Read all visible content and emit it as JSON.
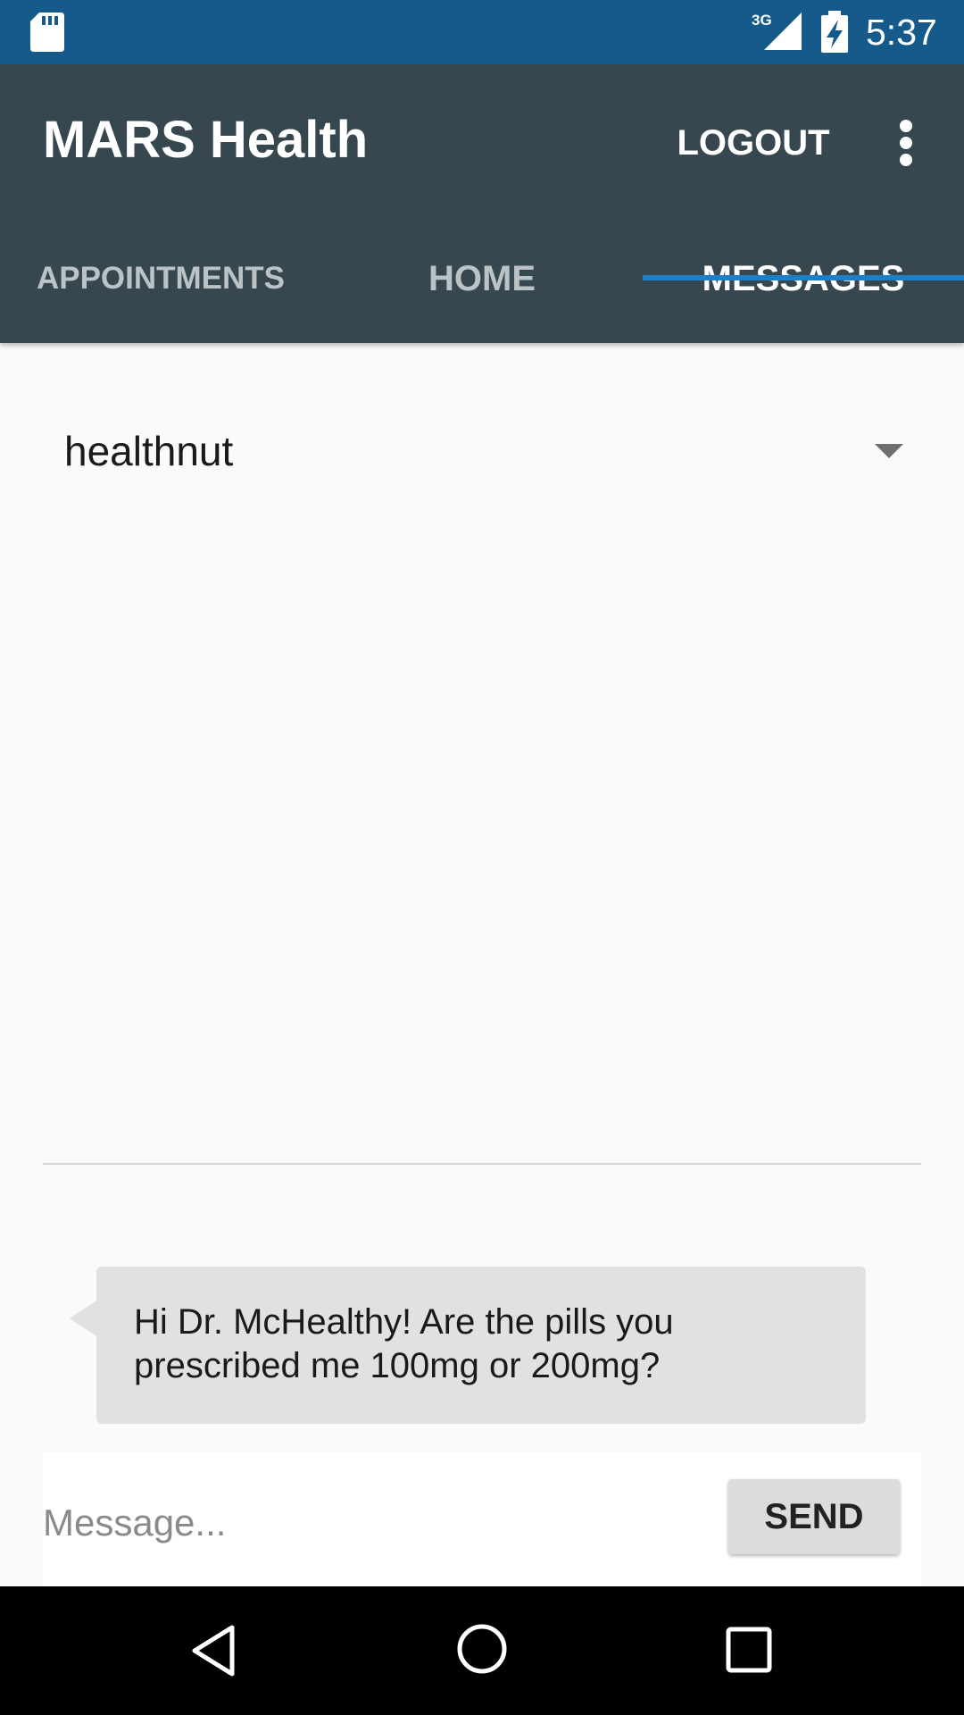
{
  "status_bar": {
    "network": "3G",
    "time": "5:37",
    "icons": [
      "sd-card-icon",
      "signal-icon",
      "battery-icon"
    ]
  },
  "app_bar": {
    "title": "MARS Health",
    "logout_label": "LOGOUT",
    "overflow_icon": "more-vert-icon",
    "background_color": "#37474f"
  },
  "tabs": [
    {
      "label": "APPOINTMENTS",
      "selected": false
    },
    {
      "label": "HOME",
      "selected": false
    },
    {
      "label": "MESSAGES",
      "selected": true
    }
  ],
  "recipient": {
    "selected_value": "healthnut"
  },
  "messages": [
    {
      "text": "Hi Dr. McHealthy! Are the pills you prescribed me 100mg or 200mg?"
    }
  ],
  "composer": {
    "placeholder": "Message...",
    "value": "",
    "send_label": "SEND"
  },
  "nav_bar": {
    "icons": [
      "back-icon",
      "home-icon",
      "recents-icon"
    ]
  },
  "colors": {
    "status_bar": "#155a8a",
    "tab_indicator": "#1e7fc6",
    "bubble": "#e1e0e2"
  }
}
